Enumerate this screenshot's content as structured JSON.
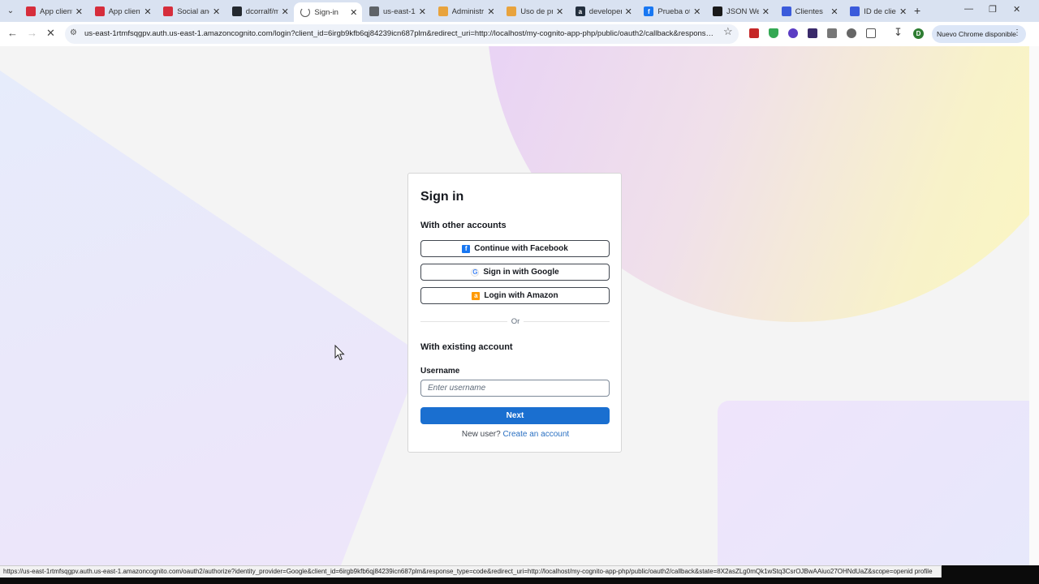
{
  "browser": {
    "tabs": [
      {
        "title": "App client",
        "fav_color": "#d62d3b",
        "fav_text": "",
        "active": false
      },
      {
        "title": "App client",
        "fav_color": "#d62d3b",
        "fav_text": "",
        "active": false
      },
      {
        "title": "Social and",
        "fav_color": "#d62d3b",
        "fav_text": "",
        "active": false
      },
      {
        "title": "dcorralf/m",
        "fav_color": "#24292f",
        "fav_text": "",
        "active": false
      },
      {
        "title": "Sign-in",
        "fav_color": "#ffffff",
        "fav_text": "",
        "active": true
      },
      {
        "title": "us-east-1r",
        "fav_color": "#5f6368",
        "fav_text": "",
        "active": false
      },
      {
        "title": "Administr",
        "fav_color": "#e8a33d",
        "fav_text": "",
        "active": false
      },
      {
        "title": "Uso de pr",
        "fav_color": "#e8a33d",
        "fav_text": "",
        "active": false
      },
      {
        "title": "developer",
        "fav_color": "#232f3e",
        "fav_text": "a",
        "active": false
      },
      {
        "title": "Prueba ot",
        "fav_color": "#1877f2",
        "fav_text": "f",
        "active": false
      },
      {
        "title": "JSON Wel",
        "fav_color": "#1a1a1a",
        "fav_text": "",
        "active": false
      },
      {
        "title": "Clientes",
        "fav_color": "#3b5bdb",
        "fav_text": "",
        "active": false
      },
      {
        "title": "ID de clie",
        "fav_color": "#3b5bdb",
        "fav_text": "",
        "active": false
      }
    ],
    "url": "us-east-1rtmfsqgpv.auth.us-east-1.amazoncognito.com/login?client_id=6irgb9kfb6qj84239icn687plm&redirect_uri=http://localhost/my-cognito-app-php/public/oauth2/callback&response_...",
    "update_label": "Nuevo Chrome disponible",
    "profile_initial": "D",
    "status_url": "https://us-east-1rtmfsqgpv.auth.us-east-1.amazoncognito.com/oauth2/authorize?identity_provider=Google&client_id=6irgb9kfb6qj84239icn687plm&response_type=code&redirect_uri=http://localhost/my-cognito-app-php/public/oauth2/callback&state=8X2asZLg0mQk1wStq3CsrOJBwAAiuo27OHNdUaZ&scope=openid profile"
  },
  "signin": {
    "title": "Sign in",
    "other_accounts_heading": "With other accounts",
    "facebook_label": "Continue with Facebook",
    "google_label": "Sign in with Google",
    "amazon_label": "Login with Amazon",
    "or_label": "Or",
    "existing_heading": "With existing account",
    "username_label": "Username",
    "username_placeholder": "Enter username",
    "next_label": "Next",
    "new_user_text": "New user?",
    "create_account_label": "Create an account"
  },
  "colors": {
    "primary": "#1a6fd0",
    "link": "#2a70c2",
    "facebook": "#1877f2",
    "amazon": "#ff9900"
  }
}
